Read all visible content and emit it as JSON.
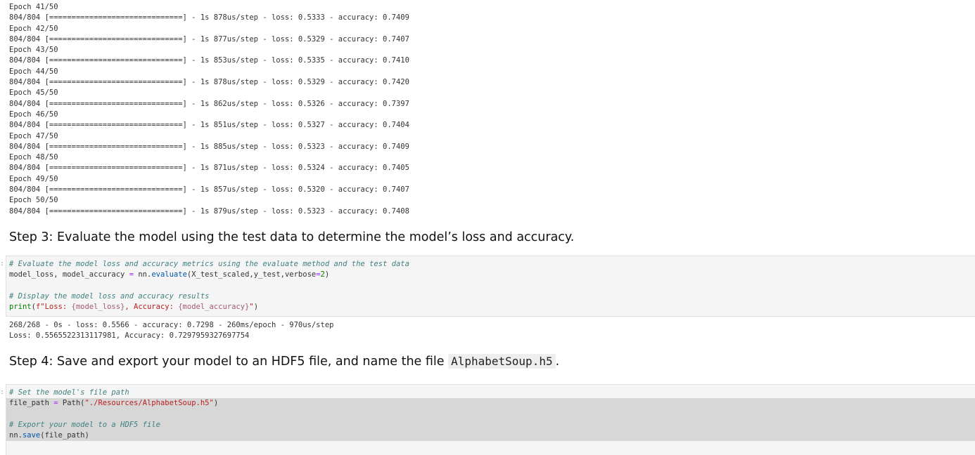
{
  "training_log": {
    "lines": [
      "Epoch 41/50",
      "804/804 [==============================] - 1s 878us/step - loss: 0.5333 - accuracy: 0.7409",
      "Epoch 42/50",
      "804/804 [==============================] - 1s 877us/step - loss: 0.5329 - accuracy: 0.7407",
      "Epoch 43/50",
      "804/804 [==============================] - 1s 853us/step - loss: 0.5335 - accuracy: 0.7410",
      "Epoch 44/50",
      "804/804 [==============================] - 1s 878us/step - loss: 0.5329 - accuracy: 0.7420",
      "Epoch 45/50",
      "804/804 [==============================] - 1s 862us/step - loss: 0.5326 - accuracy: 0.7397",
      "Epoch 46/50",
      "804/804 [==============================] - 1s 851us/step - loss: 0.5327 - accuracy: 0.7404",
      "Epoch 47/50",
      "804/804 [==============================] - 1s 885us/step - loss: 0.5323 - accuracy: 0.7409",
      "Epoch 48/50",
      "804/804 [==============================] - 1s 871us/step - loss: 0.5324 - accuracy: 0.7405",
      "Epoch 49/50",
      "804/804 [==============================] - 1s 857us/step - loss: 0.5320 - accuracy: 0.7407",
      "Epoch 50/50",
      "804/804 [==============================] - 1s 879us/step - loss: 0.5323 - accuracy: 0.7408"
    ]
  },
  "step3": {
    "heading": "Step 3: Evaluate the model using the test data to determine the model’s loss and accuracy.",
    "cell_marker": ":",
    "code": {
      "comment1": "# Evaluate the model loss and accuracy metrics using the evaluate method and the test data",
      "line2_a": "model_loss, model_accuracy ",
      "line2_op": "=",
      "line2_b": " nn.",
      "line2_fn": "evaluate",
      "line2_c": "(X_test_scaled,y_test,verbose",
      "line2_op2": "=",
      "line2_num": "2",
      "line2_d": ")",
      "comment2": "# Display the model loss and accuracy results",
      "line5_builtin": "print",
      "line5_a": "(",
      "line5_str1": "f\"Loss: ",
      "line5_interp1": "{model_loss}",
      "line5_str2": ", Accuracy: ",
      "line5_interp2": "{model_accuracy}",
      "line5_str3": "\"",
      "line5_b": ")"
    },
    "output": [
      "268/268 - 0s - loss: 0.5566 - accuracy: 0.7298 - 260ms/epoch - 970us/step",
      "Loss: 0.5565522313117981, Accuracy: 0.7297959327697754"
    ]
  },
  "step4": {
    "heading_text": "Step 4: Save and export your model to an HDF5 file, and name the file ",
    "heading_code": "AlphabetSoup.h5",
    "heading_end": ".",
    "cell_marker": ":",
    "code": {
      "comment1": "# Set the model's file path",
      "line2_a": "file_path ",
      "line2_op": "=",
      "line2_b": " Path(",
      "line2_str": "\"./Resources/AlphabetSoup.h5\"",
      "line2_c": ")",
      "comment2": "# Export your model to a HDF5 file",
      "line5_a": "nn.",
      "line5_fn": "save",
      "line5_b": "(file_path)"
    }
  }
}
